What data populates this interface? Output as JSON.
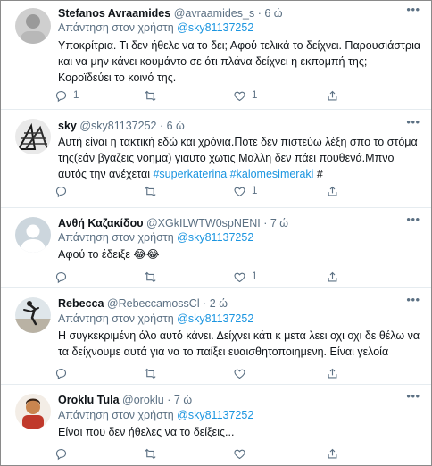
{
  "reply_prefix": "Απάντηση στον χρήστη",
  "tweets": [
    {
      "name": "Stefanos Avraamides",
      "handle": "@avraamides_s",
      "time": "6 ώ",
      "reply_to": "@sky81137252",
      "text": "Υποκρίτρια. Τι δεν ήθελε να το δει; Αφού τελικά το δείχνει. Παρουσιάστρια και να μην κάνει κουμάντο σε ότι πλάνα δείχνει η εκπομπή της; Κοροϊδεύει το κοινό της.",
      "reply_count": "1",
      "retweet_count": "",
      "like_count": "1"
    },
    {
      "name": "sky",
      "handle": "@sky81137252",
      "time": "6 ώ",
      "text_main": "Αυτή είναι η τακτική εδώ και χρόνια.Ποτε δεν πιστεύω λέξη σπο το στόμα της(εάν βγαζεις νοημα) γιαυτο χωτις Μαλλη δεν πάει πουθενά.Μπνο αυτός την ανέχεται ",
      "hashtag1": "#superkaterina",
      "hashtag2": "#kalomesimeraki",
      "text_end": " #",
      "reply_count": "",
      "retweet_count": "",
      "like_count": "1"
    },
    {
      "name": "Ανθή Καζακίδου",
      "handle": "@XGkILWTW0spNENI",
      "time": "7 ώ",
      "reply_to": "@sky81137252",
      "text": "Αφού το έδειξε 😂😂",
      "reply_count": "",
      "retweet_count": "",
      "like_count": "1"
    },
    {
      "name": "Rebecca",
      "handle": "@RebeccamossCl",
      "time": "2 ώ",
      "reply_to": "@sky81137252",
      "text": "Η συγκεκριμένη όλο αυτό κάνει. Δείχνει κάτι κ μετα λεει οχι οχι δε θέλω να τα δείχνουμε αυτά για να το παίξει ευαισθητοποιημενη. Είναι γελοία",
      "reply_count": "",
      "retweet_count": "",
      "like_count": ""
    },
    {
      "name": "Oroklu Tula",
      "handle": "@oroklu",
      "time": "7 ώ",
      "reply_to": "@sky81137252",
      "text": "Είναι που δεν ήθελες να το δείξεις...",
      "reply_count": "",
      "retweet_count": "",
      "like_count": ""
    }
  ],
  "colors": {
    "link": "#1b95e0",
    "secondary_text": "#5b7083",
    "divider": "#e6ecf0"
  },
  "icons": [
    "more-icon",
    "reply-icon",
    "retweet-icon",
    "like-icon",
    "share-icon"
  ]
}
